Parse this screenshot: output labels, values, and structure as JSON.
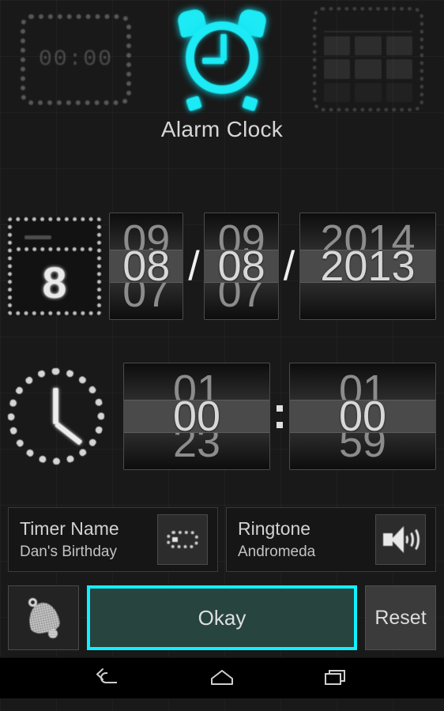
{
  "app": {
    "title": "Alarm Clock",
    "accent_cyan": "#12efff",
    "background": "#191919"
  },
  "header": {
    "icons": [
      {
        "name": "timer-icon",
        "label": "00:00"
      },
      {
        "name": "alarm-clock-icon",
        "label": ""
      },
      {
        "name": "calendar-grid-icon",
        "label": ""
      }
    ],
    "timer_display": "00:00",
    "title": "Alarm Clock"
  },
  "date_picker": {
    "icon_day": "8",
    "month": {
      "above": "09",
      "selected": "08",
      "below": "07"
    },
    "day": {
      "above": "09",
      "selected": "08",
      "below": "07"
    },
    "year": {
      "above": "2014",
      "selected": "2013",
      "below": ""
    },
    "separator": "/"
  },
  "time_picker": {
    "hour": {
      "above": "01",
      "selected": "00",
      "below": "23"
    },
    "minute": {
      "above": "01",
      "selected": "00",
      "below": "59"
    },
    "separator": ":"
  },
  "fields": [
    {
      "label": "Timer Name",
      "value": "Dan's Birthday",
      "icon": "text-field-icon"
    },
    {
      "label": "Ringtone",
      "value": "Andromeda",
      "icon": "speaker-icon"
    }
  ],
  "field_timer_name": {
    "label": "Timer Name",
    "value": "Dan's Birthday"
  },
  "field_ringtone": {
    "label": "Ringtone",
    "value": "Andromeda"
  },
  "actions": {
    "bell_icon": "bell-icon",
    "okay": "Okay",
    "reset": "Reset"
  },
  "navbar": {
    "back": "back-icon",
    "home": "home-icon",
    "recents": "recents-icon"
  }
}
